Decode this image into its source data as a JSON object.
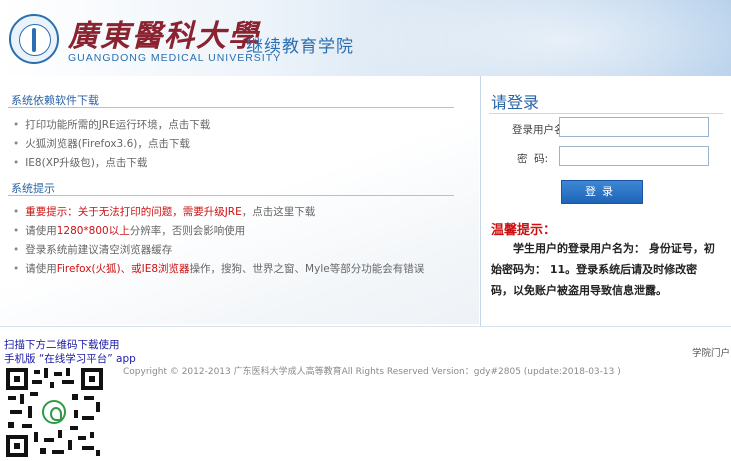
{
  "header": {
    "university_cn": "廣東醫科大學",
    "university_en": "GUANGDONG MEDICAL UNIVERSITY",
    "college": "继续教育学院"
  },
  "software": {
    "title": "系统依赖软件下载",
    "items": [
      "打印功能所需的JRE运行环境，点击下载",
      "火狐浏览器(Firefox3.6)，点击下载",
      "IE8(XP升级包)，点击下载"
    ]
  },
  "tips": {
    "title": "系统提示",
    "item1_red": "重要提示：关于无法打印的问题，需要升级JRE",
    "item1_rest": "，点击这里下载",
    "item2_pre": "请使用",
    "item2_red": "1280*800以上",
    "item2_rest": "分辨率，否则会影响使用",
    "item3": "登录系统前建议清空浏览器缓存",
    "item4_pre": "请使用",
    "item4_red": "Firefox(火狐)、或IE8浏览器",
    "item4_rest": "操作，搜狗、世界之窗、Myle等部分功能会有错误"
  },
  "login": {
    "title": "请登录",
    "username_label": "登录用户名:",
    "password_label": "密  码:",
    "username_value": "",
    "password_value": "",
    "button_label": "登录",
    "warm_title": "温馨提示：",
    "warm_text": "学生用户的登录用户名为： 身份证号，初始密码为： 11。登录系统后请及时修改密码，以免账户被盗用导致信息泄露。"
  },
  "footer": {
    "scan_line1": "扫描下方二维码下载使用",
    "scan_line2": "手机版 “在线学习平台” app",
    "copyright": "Copyright © 2012-2013 广东医科大学成人高等教育All Rights Reserved Version：gdy#2805 (update:2018-03-13 )",
    "portal_link": "学院门户"
  },
  "colors": {
    "accent_blue": "#2a63a6",
    "warning_red": "#cc1111",
    "button_blue": "#1f64b7"
  }
}
